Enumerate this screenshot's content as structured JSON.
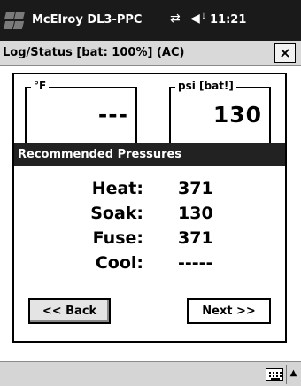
{
  "statusbar": {
    "title": "McElroy DL3-PPC",
    "clock": "11:21",
    "start_icon": "windows-flag-icon",
    "connection_icon": "connectivity-icon",
    "volume_icon": "volume-icon"
  },
  "window": {
    "caption": "Log/Status  [bat: 100%] (AC)",
    "close_label": "×"
  },
  "readings": {
    "temp_label": "°F",
    "temp_value": "---",
    "pressure_label": "psi [bat!]",
    "pressure_value": "130"
  },
  "recommended": {
    "header": "Recommended Pressures",
    "rows": [
      {
        "label": "Heat:",
        "value": "371"
      },
      {
        "label": "Soak:",
        "value": "130"
      },
      {
        "label": "Fuse:",
        "value": "371"
      },
      {
        "label": "Cool:",
        "value": "-----"
      }
    ]
  },
  "buttons": {
    "back": "<< Back",
    "next": "Next >>"
  },
  "menubar": {
    "keyboard_icon": "keyboard-icon",
    "arrow_icon": "caret-up-icon"
  },
  "colors": {
    "titlebar": "#1a1a1a",
    "header_band": "#222222",
    "caption_bg": "#d9d9d9"
  }
}
